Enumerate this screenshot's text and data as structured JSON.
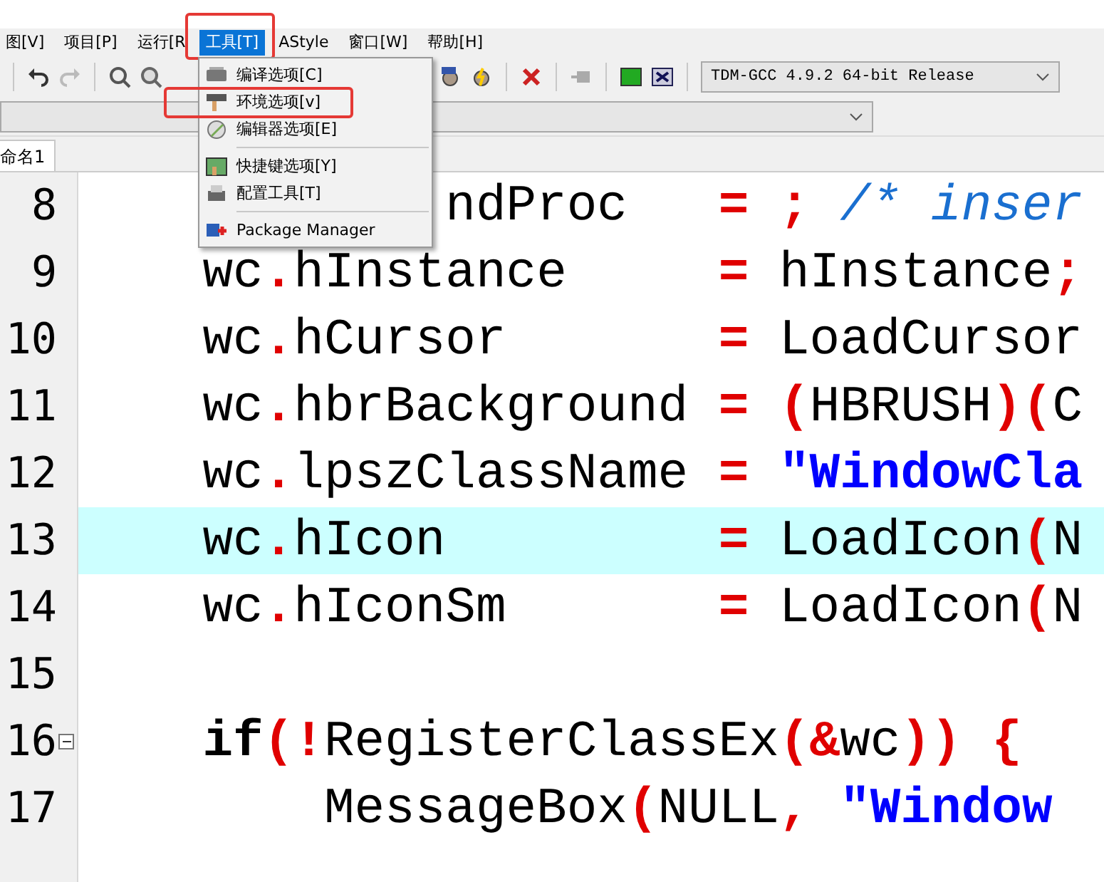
{
  "menu_bar": [
    {
      "label": "图[V]",
      "selected": false,
      "annotated": false
    },
    {
      "label": "项目[P]",
      "selected": false,
      "annotated": false
    },
    {
      "label": "运行[R",
      "selected": false,
      "annotated": false
    },
    {
      "label": "工具[T]",
      "selected": true,
      "annotated": true
    },
    {
      "label": "AStyle",
      "selected": false,
      "annotated": false
    },
    {
      "label": "窗口[W]",
      "selected": false,
      "annotated": false
    },
    {
      "label": "帮助[H]",
      "selected": false,
      "annotated": false
    }
  ],
  "tools_menu": {
    "items": [
      {
        "kind": "item",
        "label": "编译选项[C]",
        "annotated": false
      },
      {
        "kind": "item",
        "label": "环境选项[v]",
        "annotated": true
      },
      {
        "kind": "item",
        "label": "编辑器选项[E]",
        "annotated": false
      },
      {
        "kind": "separator"
      },
      {
        "kind": "item",
        "label": "快捷键选项[Y]",
        "annotated": false
      },
      {
        "kind": "item",
        "label": "配置工具[T]",
        "annotated": false
      },
      {
        "kind": "separator"
      },
      {
        "kind": "item",
        "label": "Package Manager",
        "annotated": false
      }
    ]
  },
  "toolbar": {
    "compiler": "TDM-GCC 4.9.2 64-bit Release"
  },
  "tabs": [
    {
      "label": "命名1",
      "selected": true
    }
  ],
  "editor": {
    "lines": [
      {
        "number": "8",
        "current": false,
        "fold": false,
        "segments": [
          {
            "kind": "plain",
            "text": "            ndProc   "
          },
          {
            "kind": "op",
            "text": "= ; "
          },
          {
            "kind": "comment",
            "text": "/* inser"
          }
        ]
      },
      {
        "number": "9",
        "current": false,
        "fold": false,
        "segments": [
          {
            "kind": "plain",
            "text": "    wc"
          },
          {
            "kind": "op",
            "text": "."
          },
          {
            "kind": "plain",
            "text": "hInstance     "
          },
          {
            "kind": "op",
            "text": "="
          },
          {
            "kind": "plain",
            "text": " hInstance"
          },
          {
            "kind": "op",
            "text": ";"
          }
        ]
      },
      {
        "number": "10",
        "current": false,
        "fold": false,
        "segments": [
          {
            "kind": "plain",
            "text": "    wc"
          },
          {
            "kind": "op",
            "text": "."
          },
          {
            "kind": "plain",
            "text": "hCursor       "
          },
          {
            "kind": "op",
            "text": "="
          },
          {
            "kind": "plain",
            "text": " LoadCursor"
          }
        ]
      },
      {
        "number": "11",
        "current": false,
        "fold": false,
        "segments": [
          {
            "kind": "plain",
            "text": "    wc"
          },
          {
            "kind": "op",
            "text": "."
          },
          {
            "kind": "plain",
            "text": "hbrBackground "
          },
          {
            "kind": "op",
            "text": "= ("
          },
          {
            "kind": "plain",
            "text": "HBRUSH"
          },
          {
            "kind": "op",
            "text": ")("
          },
          {
            "kind": "plain",
            "text": "C"
          }
        ]
      },
      {
        "number": "12",
        "current": false,
        "fold": false,
        "segments": [
          {
            "kind": "plain",
            "text": "    wc"
          },
          {
            "kind": "op",
            "text": "."
          },
          {
            "kind": "plain",
            "text": "lpszClassName "
          },
          {
            "kind": "op",
            "text": "= "
          },
          {
            "kind": "string",
            "text": "\"WindowCla"
          }
        ]
      },
      {
        "number": "13",
        "current": true,
        "fold": false,
        "segments": [
          {
            "kind": "plain",
            "text": "    wc"
          },
          {
            "kind": "op",
            "text": "."
          },
          {
            "kind": "plain",
            "text": "hIcon         "
          },
          {
            "kind": "op",
            "text": "="
          },
          {
            "kind": "plain",
            "text": " LoadIcon"
          },
          {
            "kind": "op",
            "text": "("
          },
          {
            "kind": "plain",
            "text": "N"
          }
        ]
      },
      {
        "number": "14",
        "current": false,
        "fold": false,
        "segments": [
          {
            "kind": "plain",
            "text": "    wc"
          },
          {
            "kind": "op",
            "text": "."
          },
          {
            "kind": "plain",
            "text": "hIconSm       "
          },
          {
            "kind": "op",
            "text": "="
          },
          {
            "kind": "plain",
            "text": " LoadIcon"
          },
          {
            "kind": "op",
            "text": "("
          },
          {
            "kind": "plain",
            "text": "N"
          }
        ]
      },
      {
        "number": "15",
        "current": false,
        "fold": false
      },
      {
        "number": "16",
        "current": false,
        "fold": true,
        "segments": [
          {
            "kind": "keyword",
            "text": "    if"
          },
          {
            "kind": "op",
            "text": "(!"
          },
          {
            "kind": "plain",
            "text": "RegisterClassEx"
          },
          {
            "kind": "op",
            "text": "(&"
          },
          {
            "kind": "plain",
            "text": "wc"
          },
          {
            "kind": "op",
            "text": ")) {"
          }
        ]
      },
      {
        "number": "17",
        "current": false,
        "fold": false,
        "segments": [
          {
            "kind": "plain",
            "text": "        MessageBox"
          },
          {
            "kind": "op",
            "text": "("
          },
          {
            "kind": "plain",
            "text": "NULL"
          },
          {
            "kind": "op",
            "text": ", "
          },
          {
            "kind": "string",
            "text": "\"Window"
          }
        ]
      }
    ]
  }
}
